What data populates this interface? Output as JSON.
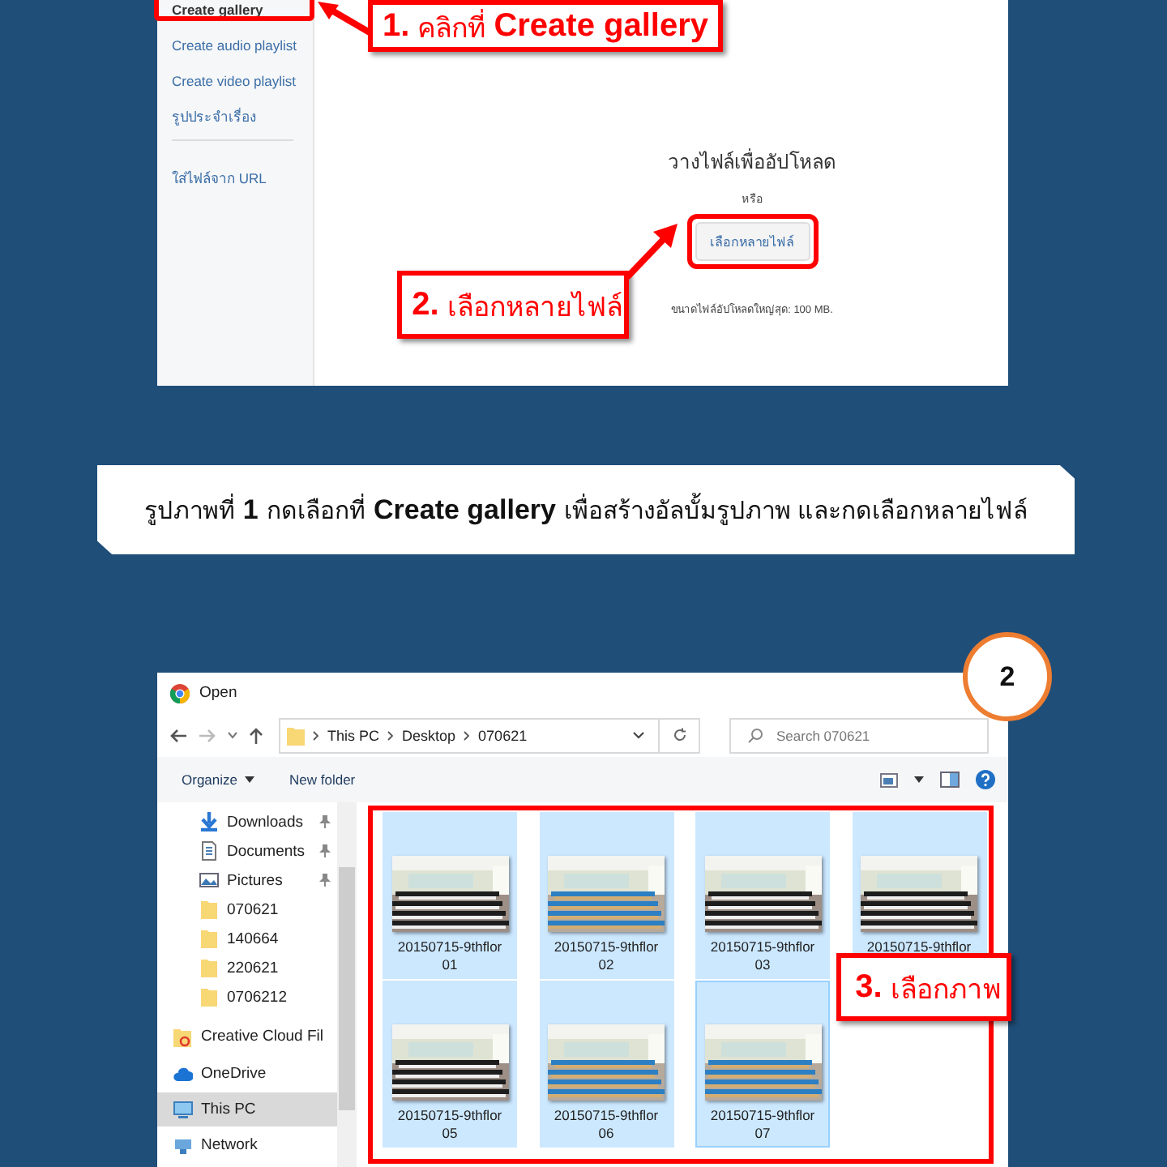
{
  "step1": {
    "sidebar": {
      "items": [
        {
          "label": "Create gallery",
          "selected": true
        },
        {
          "label": "Create audio playlist",
          "selected": false
        },
        {
          "label": "Create video playlist",
          "selected": false
        },
        {
          "label": "รูปประจำเรื่อง",
          "selected": false
        },
        {
          "label": "ใส่ไฟล์จาก URL",
          "selected": false
        }
      ]
    },
    "upload": {
      "drop_text": "วางไฟล์เพื่ออัปโหลด",
      "or_text": "หรือ",
      "choose_button": "เลือกหลายไฟล์",
      "size_note": "ขนาดไฟล์อัปโหลดใหญ่สุด: 100 MB."
    },
    "callouts": [
      "**1.** คลิกที่ **Create gallery**",
      "**2.** เลือกหลายไฟล์"
    ]
  },
  "caption": "รูปภาพที่ **1**  กดเลือกที่ **Create gallery** เพื่อสร้างอัลบั้มรูปภาพ และกดเลือกหลายไฟล์",
  "step2": {
    "badge": "2",
    "dialog": {
      "title": "Open",
      "breadcrumb": [
        "This PC",
        "Desktop",
        "070621"
      ],
      "search": {
        "placeholder": "Search 070621"
      },
      "toolbar": [
        "Organize",
        "New folder"
      ],
      "nav_items": [
        {
          "label": "Downloads",
          "kind": "downloads",
          "pinned": true,
          "selected": false
        },
        {
          "label": "Documents",
          "kind": "documents",
          "pinned": true,
          "selected": false
        },
        {
          "label": "Pictures",
          "kind": "pictures",
          "pinned": true,
          "selected": false
        },
        {
          "label": "070621",
          "kind": "folder",
          "pinned": false,
          "selected": false
        },
        {
          "label": "140664",
          "kind": "folder",
          "pinned": false,
          "selected": false
        },
        {
          "label": "220621",
          "kind": "folder",
          "pinned": false,
          "selected": false
        },
        {
          "label": "0706212",
          "kind": "folder",
          "pinned": false,
          "selected": false
        },
        {
          "label": "Creative Cloud Fil",
          "kind": "cloudfolder",
          "pinned": false,
          "selected": false
        },
        {
          "label": "OneDrive",
          "kind": "onedrive",
          "pinned": false,
          "selected": false
        },
        {
          "label": "This PC",
          "kind": "pc",
          "pinned": false,
          "selected": true
        },
        {
          "label": "Network",
          "kind": "network",
          "pinned": false,
          "selected": false
        }
      ],
      "files": [
        {
          "name_lines": [
            "20150715-9thflor",
            "01"
          ],
          "selected": true,
          "focused": false
        },
        {
          "name_lines": [
            "20150715-9thflor",
            "02"
          ],
          "selected": true,
          "focused": false
        },
        {
          "name_lines": [
            "20150715-9thflor",
            "03"
          ],
          "selected": true,
          "focused": false
        },
        {
          "name_lines": [
            "20150715-9thflor"
          ],
          "selected": true,
          "focused": false
        },
        {
          "name_lines": [
            "20150715-9thflor",
            "05"
          ],
          "selected": true,
          "focused": false
        },
        {
          "name_lines": [
            "20150715-9thflor",
            "06"
          ],
          "selected": true,
          "focused": false
        },
        {
          "name_lines": [
            "20150715-9thflor",
            "07"
          ],
          "selected": true,
          "focused": true
        }
      ]
    },
    "callout": "**3.** เลือกภาพ"
  }
}
